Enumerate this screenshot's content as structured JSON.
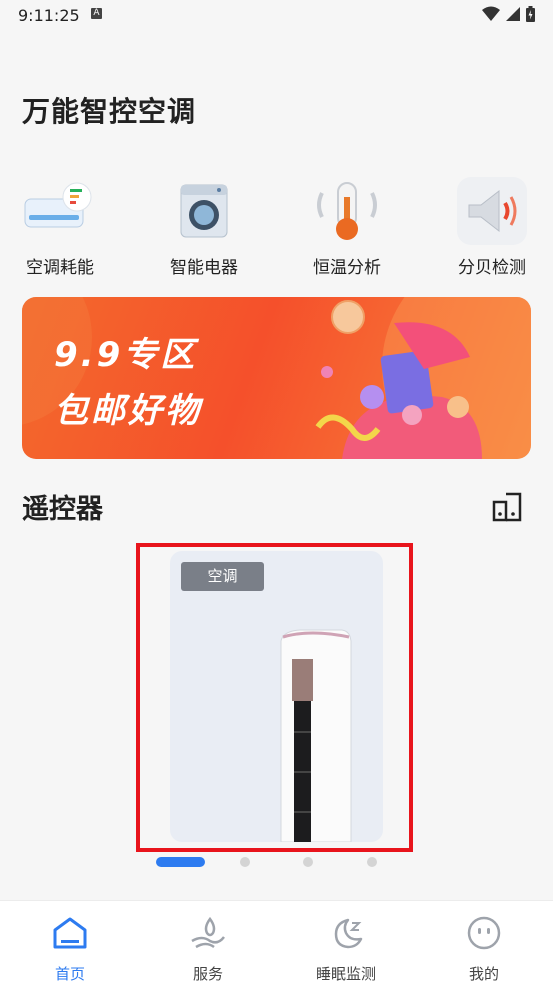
{
  "status_bar": {
    "time": "9:11:25",
    "indicator": "A"
  },
  "header": {
    "title": "万能智控空调"
  },
  "features": [
    {
      "label": "空调耗能",
      "icon": "ac-energy-icon"
    },
    {
      "label": "智能电器",
      "icon": "washing-machine-icon"
    },
    {
      "label": "恒温分析",
      "icon": "thermometer-icon"
    },
    {
      "label": "分贝检测",
      "icon": "speaker-icon"
    }
  ],
  "banner": {
    "line1": "9.9专区",
    "line2": "包邮好物"
  },
  "remote_section": {
    "title": "遥控器"
  },
  "device_card": {
    "tag": "空调",
    "image": "standing-air-conditioner"
  },
  "pager": {
    "count": 4,
    "active_index": 0
  },
  "bottom_nav": [
    {
      "label": "首页",
      "icon": "home-icon",
      "active": true
    },
    {
      "label": "服务",
      "icon": "service-icon",
      "active": false
    },
    {
      "label": "睡眠监测",
      "icon": "sleep-moon-icon",
      "active": false
    },
    {
      "label": "我的",
      "icon": "profile-face-icon",
      "active": false
    }
  ],
  "colors": {
    "accent": "#2d7bf0",
    "highlight_frame": "#e8141c",
    "banner": "#f5502b"
  }
}
